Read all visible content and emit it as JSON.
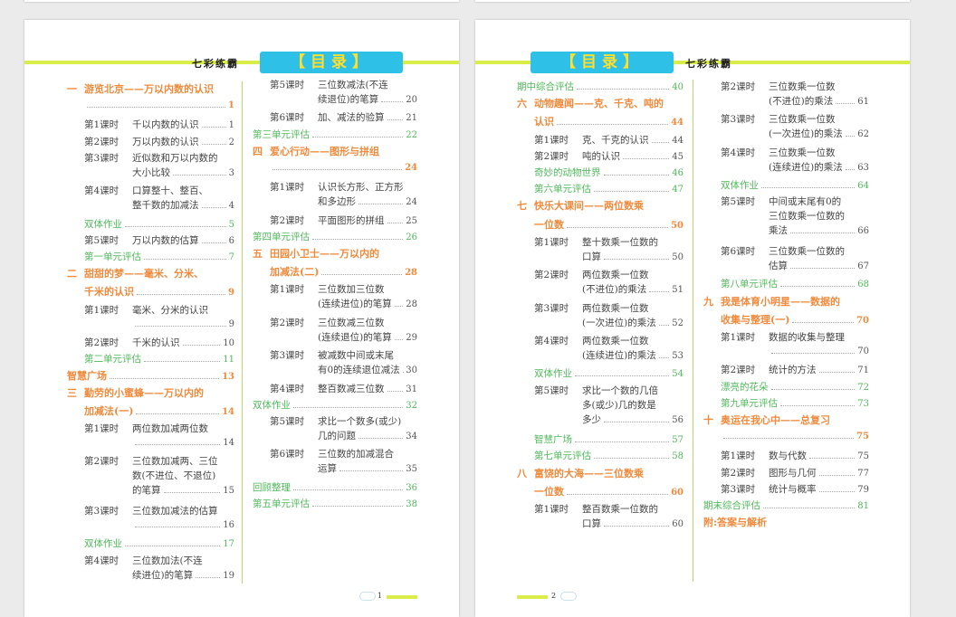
{
  "header": {
    "banner": "【目录】",
    "brand": "七彩练霸"
  },
  "pages": [
    {
      "number": "1",
      "columns": [
        [
          {
            "t": "u",
            "num": "一",
            "l1": "游览北京——万以内数的认识",
            "pg": "1"
          },
          {
            "t": "l",
            "label": "第1课时",
            "l1": "千以内数的认识",
            "pg": "1"
          },
          {
            "t": "l",
            "label": "第2课时",
            "l1": "万以内数的认识",
            "pg": "2"
          },
          {
            "t": "l",
            "label": "第3课时",
            "l1": "近似数和万以内数的",
            "l2": "大小比较",
            "pg": "3"
          },
          {
            "t": "l",
            "label": "第4课时",
            "l1": "口算整十、整百、",
            "l2": "整千数的加减法",
            "pg": "4"
          },
          {
            "t": "g",
            "l1": "双体作业",
            "pg": "5"
          },
          {
            "t": "l",
            "label": "第5课时",
            "l1": "万以内数的估算",
            "pg": "6"
          },
          {
            "t": "g",
            "l1": "第一单元评估",
            "pg": "7"
          },
          {
            "t": "u",
            "num": "二",
            "l1": "甜甜的梦——毫米、分米、",
            "l2": "千米的认识",
            "pg": "9"
          },
          {
            "t": "l",
            "label": "第1课时",
            "l1": "毫米、分米的认识",
            "pg": "9"
          },
          {
            "t": "l",
            "label": "第2课时",
            "l1": "千米的认识",
            "pg": "10"
          },
          {
            "t": "g",
            "l1": "第二单元评估",
            "pg": "11"
          },
          {
            "t": "o",
            "l1": "智慧广场",
            "pg": "13"
          },
          {
            "t": "u",
            "num": "三",
            "l1": "勤劳的小蜜蜂——万以内的",
            "l2": "加减法(一)",
            "pg": "14"
          },
          {
            "t": "l",
            "label": "第1课时",
            "l1": "两位数加减两位数",
            "pg": "14"
          },
          {
            "t": "l",
            "label": "第2课时",
            "l1": "三位数加减两、三位",
            "l2": "数(不进位、不退位)",
            "l3": "的笔算",
            "pg": "15"
          },
          {
            "t": "l",
            "label": "第3课时",
            "l1": "三位数加减法的估算",
            "pg": "16"
          },
          {
            "t": "g",
            "l1": "双体作业",
            "pg": "17"
          },
          {
            "t": "l",
            "label": "第4课时",
            "l1": "三位数加法(不连",
            "l2": "续进位)的笔算",
            "pg": "19"
          }
        ],
        [
          {
            "t": "l",
            "label": "第5课时",
            "l1": "三位数减法(不连",
            "l2": "续退位)的笔算",
            "pg": "20"
          },
          {
            "t": "l",
            "label": "第6课时",
            "l1": "加、减法的验算",
            "pg": "21"
          },
          {
            "t": "g",
            "l1": "第三单元评估",
            "pg": "22"
          },
          {
            "t": "u",
            "num": "四",
            "l1": "爱心行动——图形与拼组",
            "pg": "24"
          },
          {
            "t": "l",
            "label": "第1课时",
            "l1": "认识长方形、正方形",
            "l2": "和多边形",
            "pg": "24"
          },
          {
            "t": "l",
            "label": "第2课时",
            "l1": "平面图形的拼组",
            "pg": "25"
          },
          {
            "t": "g",
            "l1": "第四单元评估",
            "pg": "26"
          },
          {
            "t": "u",
            "num": "五",
            "l1": "田园小卫士——万以内的",
            "l2": "加减法(二)",
            "pg": "28"
          },
          {
            "t": "l",
            "label": "第1课时",
            "l1": "三位数加三位数",
            "l2": "(连续进位)的笔算",
            "pg": "28"
          },
          {
            "t": "l",
            "label": "第2课时",
            "l1": "三位数减三位数",
            "l2": "(连续退位)的笔算",
            "pg": "29"
          },
          {
            "t": "l",
            "label": "第3课时",
            "l1": "被减数中间或末尾",
            "l2": "有0的连续退位减法",
            "pg": "30"
          },
          {
            "t": "l",
            "label": "第4课时",
            "l1": "整百数减三位数",
            "pg": "31"
          },
          {
            "t": "g",
            "l1": "双体作业",
            "pg": "32"
          },
          {
            "t": "l",
            "label": "第5课时",
            "l1": "求比一个数多(或少)",
            "l2": "几的问题",
            "pg": "34"
          },
          {
            "t": "l",
            "label": "第6课时",
            "l1": "三位数的加减混合",
            "l2": "运算",
            "pg": "35"
          },
          {
            "t": "g",
            "l1": "回顾整理",
            "pg": "36"
          },
          {
            "t": "g",
            "l1": "第五单元评估",
            "pg": "38"
          }
        ]
      ]
    },
    {
      "number": "2",
      "columns": [
        [
          {
            "t": "g",
            "l1": "期中综合评估",
            "pg": "40"
          },
          {
            "t": "u",
            "num": "六",
            "l1": "动物趣闻——克、千克、吨的",
            "l2": "认识",
            "pg": "44"
          },
          {
            "t": "l",
            "label": "第1课时",
            "l1": "克、千克的认识",
            "pg": "44"
          },
          {
            "t": "l",
            "label": "第2课时",
            "l1": "吨的认识",
            "pg": "45"
          },
          {
            "t": "g",
            "l1": "奇妙的动物世界",
            "pg": "46"
          },
          {
            "t": "g",
            "l1": "第六单元评估",
            "pg": "47"
          },
          {
            "t": "u",
            "num": "七",
            "l1": "快乐大课间——两位数乘",
            "l2": "一位数",
            "pg": "50"
          },
          {
            "t": "l",
            "label": "第1课时",
            "l1": "整十数乘一位数的",
            "l2": "口算",
            "pg": "50"
          },
          {
            "t": "l",
            "label": "第2课时",
            "l1": "两位数乘一位数",
            "l2": "(不进位)的乘法",
            "pg": "51"
          },
          {
            "t": "l",
            "label": "第3课时",
            "l1": "两位数乘一位数",
            "l2": "(一次进位)的乘法",
            "pg": "52"
          },
          {
            "t": "l",
            "label": "第4课时",
            "l1": "两位数乘一位数",
            "l2": "(连续进位)的乘法",
            "pg": "53"
          },
          {
            "t": "g",
            "l1": "双体作业",
            "pg": "54"
          },
          {
            "t": "l",
            "label": "第5课时",
            "l1": "求比一个数的几倍",
            "l2": "多(或少)几的数是",
            "l3": "多少",
            "pg": "56"
          },
          {
            "t": "g",
            "l1": "智慧广场",
            "pg": "57"
          },
          {
            "t": "g",
            "l1": "第七单元评估",
            "pg": "58"
          },
          {
            "t": "u",
            "num": "八",
            "l1": "富饶的大海——三位数乘",
            "l2": "一位数",
            "pg": "60"
          },
          {
            "t": "l",
            "label": "第1课时",
            "l1": "整百数乘一位数的",
            "l2": "口算",
            "pg": "60"
          }
        ],
        [
          {
            "t": "l",
            "label": "第2课时",
            "l1": "三位数乘一位数",
            "l2": "(不进位)的乘法",
            "pg": "61"
          },
          {
            "t": "l",
            "label": "第3课时",
            "l1": "三位数乘一位数",
            "l2": "(一次进位)的乘法",
            "pg": "62"
          },
          {
            "t": "l",
            "label": "第4课时",
            "l1": "三位数乘一位数",
            "l2": "(连续进位)的乘法",
            "pg": "63"
          },
          {
            "t": "g",
            "l1": "双体作业",
            "pg": "64"
          },
          {
            "t": "l",
            "label": "第5课时",
            "l1": "中间或末尾有0的",
            "l2": "三位数乘一位数的",
            "l3": "乘法",
            "pg": "66"
          },
          {
            "t": "l",
            "label": "第6课时",
            "l1": "三位数乘一位数的",
            "l2": "估算",
            "pg": "67"
          },
          {
            "t": "g",
            "l1": "第八单元评估",
            "pg": "68"
          },
          {
            "t": "u",
            "num": "九",
            "l1": "我是体育小明星——数据的",
            "l2": "收集与整理(一)",
            "pg": "70"
          },
          {
            "t": "l",
            "label": "第1课时",
            "l1": "数据的收集与整理",
            "pg": "70"
          },
          {
            "t": "l",
            "label": "第2课时",
            "l1": "统计的方法",
            "pg": "71"
          },
          {
            "t": "g",
            "l1": "漂亮的花朵",
            "pg": "72"
          },
          {
            "t": "g",
            "l1": "第九单元评估",
            "pg": "73"
          },
          {
            "t": "u",
            "num": "十",
            "l1": "奥运在我心中——总复习",
            "pg": "75"
          },
          {
            "t": "l",
            "label": "第1课时",
            "l1": "数与代数",
            "pg": "75"
          },
          {
            "t": "l",
            "label": "第2课时",
            "l1": "图形与几何",
            "pg": "77"
          },
          {
            "t": "l",
            "label": "第3课时",
            "l1": "统计与概率",
            "pg": "79"
          },
          {
            "t": "g",
            "l1": "期末综合评估",
            "pg": "81"
          },
          {
            "t": "o",
            "l1": "附:答案与解析"
          }
        ]
      ]
    }
  ],
  "colors": {
    "orange": "#f08a3c",
    "green": "#4fb85a",
    "banner": "#2ec0e6",
    "banner_text": "#ffdf2a",
    "rule": "#d9ec48"
  }
}
